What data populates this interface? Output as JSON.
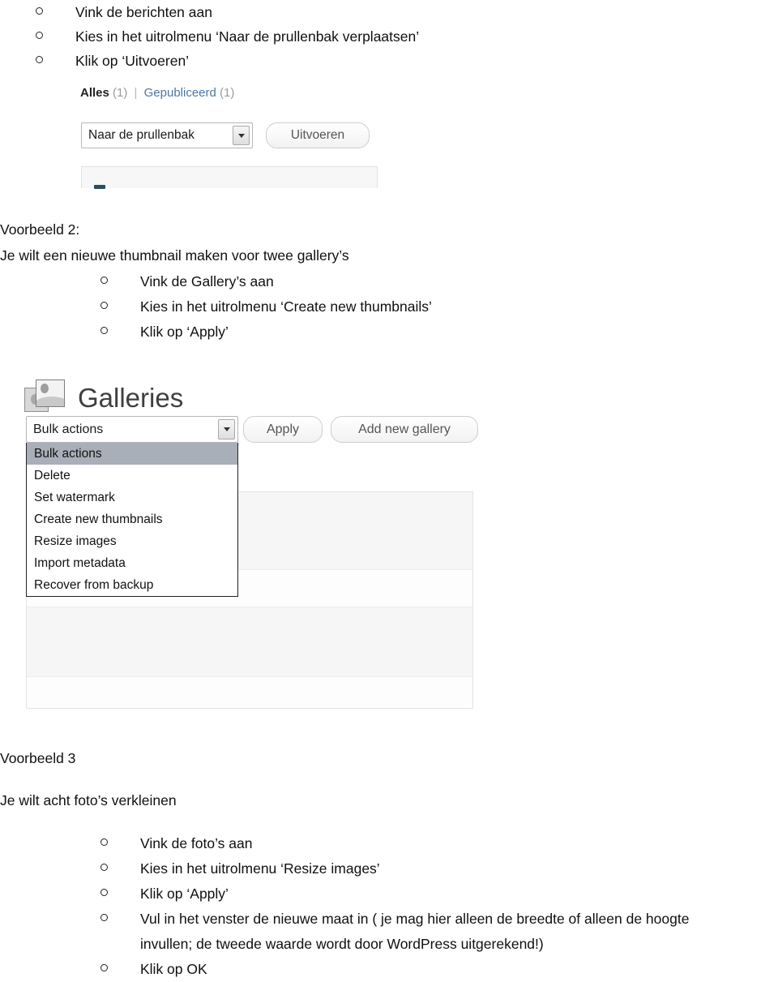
{
  "document": {
    "sections": [
      {
        "id": "example1-steps",
        "bullets": [
          "Vink de berichten aan",
          "Kies in het uitrolmenu ‘Naar de prullenbak verplaatsen’",
          "Klik op ‘Uitvoeren’"
        ]
      },
      {
        "id": "example2",
        "heading": "Voorbeeld 2:",
        "intro": "Je wilt een nieuwe thumbnail maken voor twee gallery’s",
        "bullets": [
          "Vink de Gallery’s aan",
          "Kies in het uitrolmenu ‘Create new thumbnails’",
          "Klik op ‘Apply’"
        ]
      },
      {
        "id": "example3",
        "heading": "Voorbeeld 3",
        "intro": "Je wilt acht foto’s verkleinen",
        "bullets": [
          "Vink de foto’s aan",
          "Kies in het uitrolmenu ‘Resize images’",
          "Klik op ‘Apply’",
          "Vul in het venster de nieuwe maat in ( je mag hier alleen de breedte of alleen de hoogte",
          "invullen; de tweede waarde wordt door WordPress uitgerekend!)",
          "Klik op OK"
        ]
      }
    ]
  },
  "screenshot_posts": {
    "views": {
      "all_label": "Alles",
      "all_count": "(1)",
      "separator": "|",
      "published_label": "Gepubliceerd",
      "published_count": "(1)"
    },
    "bulk_select": {
      "value": "Naar de prullenbak",
      "arrow_icon": "chevron-down-icon"
    },
    "apply_button": "Uitvoeren"
  },
  "screenshot_galleries": {
    "page_title": "Galleries",
    "page_icon": "gallery-images-icon",
    "bulk_select": {
      "value": "Bulk actions",
      "arrow_icon": "chevron-down-icon"
    },
    "apply_button": "Apply",
    "add_button": "Add new gallery",
    "dropdown_options": [
      "Bulk actions",
      "Delete",
      "Set watermark",
      "Create new thumbnails",
      "Resize images",
      "Import metadata",
      "Recover from backup"
    ],
    "selected_option_index": 0
  },
  "colors": {
    "link_blue": "#4a77a8",
    "muted_gray": "#9a9a9a",
    "dropdown_highlight": "#a9afb8",
    "title_gray": "#3f3f3f"
  }
}
